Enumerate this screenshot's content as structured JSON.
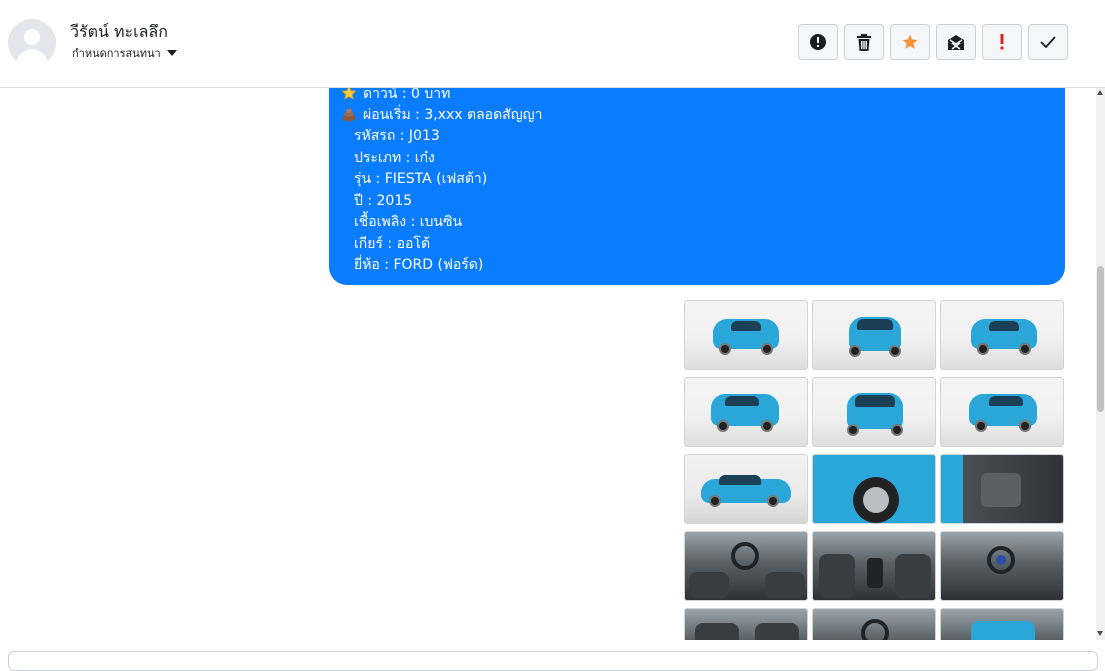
{
  "contact": {
    "name": "วีรัตน์ ทะเลลึก",
    "assign_label": "กำหนดการสนทนา"
  },
  "actions": [
    {
      "name": "spam-button",
      "icon": "alert-circle-icon",
      "color": "#1c1e21"
    },
    {
      "name": "delete-button",
      "icon": "trash-icon",
      "color": "#1c1e21"
    },
    {
      "name": "star-button",
      "icon": "star-icon",
      "color": "#f7923b"
    },
    {
      "name": "mark-unread-button",
      "icon": "envelope-x-icon",
      "color": "#1c1e21"
    },
    {
      "name": "important-button",
      "icon": "exclamation-icon",
      "color": "#e02020"
    },
    {
      "name": "done-button",
      "icon": "check-icon",
      "color": "#1c1e21"
    }
  ],
  "message": {
    "bubble_color": "#0a7cff",
    "lines": [
      {
        "emoji": "star",
        "text": "ดาวน์ : 0 บาท"
      },
      {
        "emoji": "poop",
        "text": "ผ่อนเริ่ม : 3,xxx ตลอดสัญญา"
      },
      {
        "text": "รหัสรถ : J013"
      },
      {
        "text": "ประเภท : เก๋ง"
      },
      {
        "text": "รุ่น : FIESTA (เฟสต้า)"
      },
      {
        "text": "ปี : 2015"
      },
      {
        "text": "เชื้อเพลิง : เบนซิน"
      },
      {
        "text": "เกียร์ : ออโต้"
      },
      {
        "text": "ยี่ห้อ : FORD (ฟอร์ด)"
      }
    ]
  },
  "photos": [
    "car-front-left-photo",
    "car-front-photo",
    "car-front-right-photo",
    "car-rear-left-photo",
    "car-rear-photo",
    "car-rear-right-photo",
    "car-side-photo",
    "car-wheel-photo",
    "car-door-interior-photo",
    "car-dashboard-photo",
    "car-gear-console-photo",
    "car-steering-photo",
    "car-seats-photo",
    "car-cabin-photo",
    "car-trunk-photo"
  ]
}
